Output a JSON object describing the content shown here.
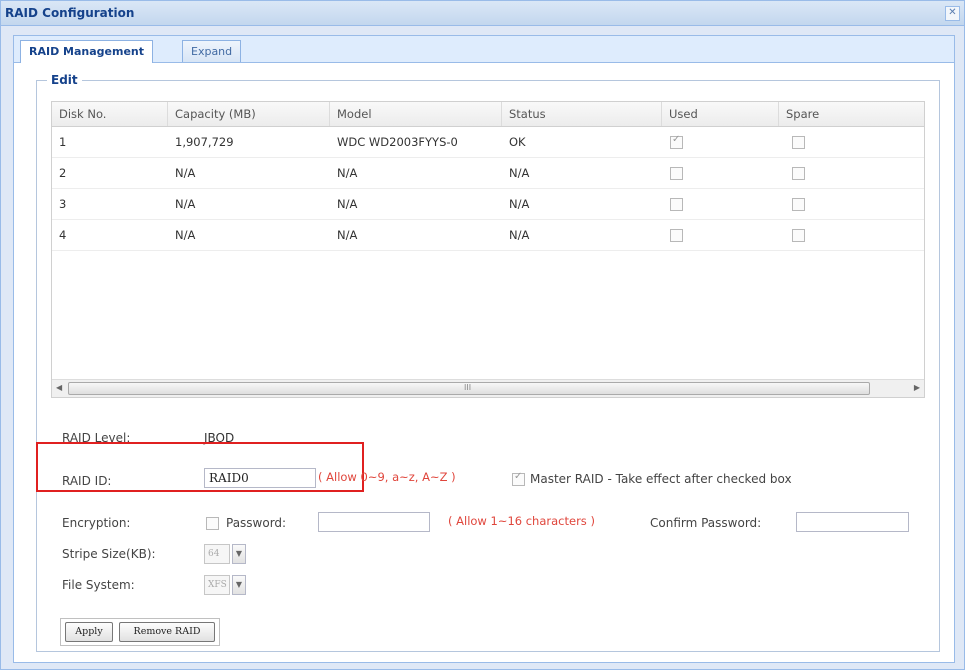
{
  "window": {
    "title": "RAID Configuration",
    "close_glyph": "✕"
  },
  "tabs": [
    {
      "label": "RAID Management",
      "active": true
    },
    {
      "label": "Expand",
      "active": false
    }
  ],
  "section": {
    "legend": "Edit"
  },
  "table": {
    "headers": [
      "Disk No.",
      "Capacity (MB)",
      "Model",
      "Status",
      "Used",
      "Spare"
    ],
    "rows": [
      {
        "disk": "1",
        "capacity": "1,907,729",
        "model": "WDC WD2003FYYS-0",
        "status": "OK",
        "used": true,
        "spare": false
      },
      {
        "disk": "2",
        "capacity": "N/A",
        "model": "N/A",
        "status": "N/A",
        "used": false,
        "spare": false
      },
      {
        "disk": "3",
        "capacity": "N/A",
        "model": "N/A",
        "status": "N/A",
        "used": false,
        "spare": false
      },
      {
        "disk": "4",
        "capacity": "N/A",
        "model": "N/A",
        "status": "N/A",
        "used": false,
        "spare": false
      }
    ],
    "scroll_grip": "III"
  },
  "form": {
    "raid_level_label": "RAID Level:",
    "raid_level_value": "JBOD",
    "raid_id_label": "RAID ID:",
    "raid_id_value": "RAID0",
    "raid_id_hint": "( Allow 0~9, a~z, A~Z )",
    "master_raid_label": "Master RAID - Take effect after checked box",
    "master_raid_checked": true,
    "encryption_label": "Encryption:",
    "encryption_checked": false,
    "password_label": "Password:",
    "password_value": "",
    "password_hint": "( Allow 1~16 characters )",
    "confirm_password_label": "Confirm Password:",
    "confirm_password_value": "",
    "stripe_size_label": "Stripe Size(KB):",
    "stripe_size_value": "64",
    "file_system_label": "File System:",
    "file_system_value": "XFS"
  },
  "buttons": {
    "apply": "Apply",
    "remove_raid": "Remove RAID"
  },
  "colors": {
    "accent": "#15428b",
    "hint": "#e0463c",
    "highlight_box": "#e02020"
  }
}
